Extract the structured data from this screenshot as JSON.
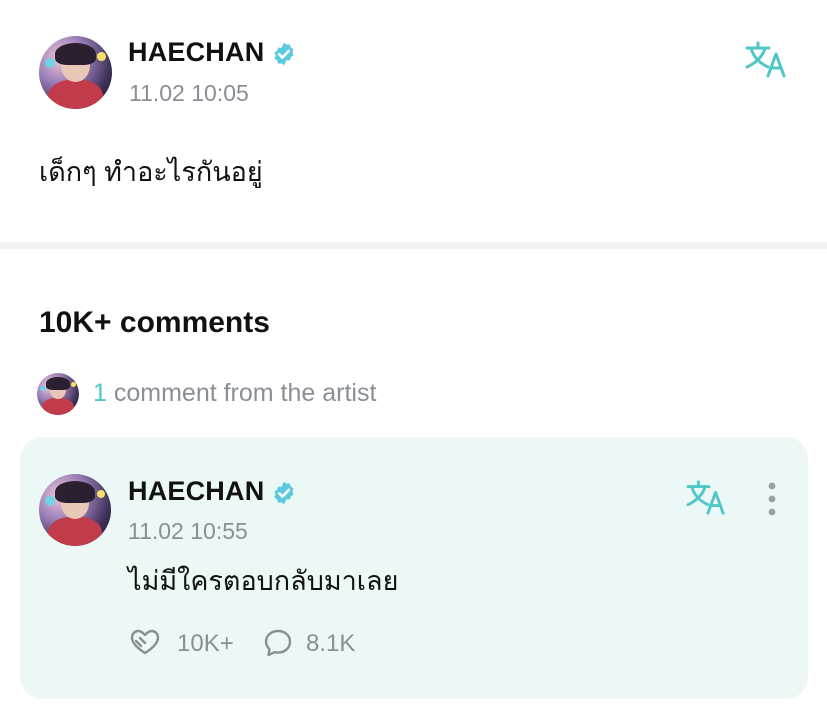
{
  "post": {
    "author": "HAECHAN",
    "verified": true,
    "time": "11.02 10:05",
    "text": "เด็กๆ ทำอะไรกันอยู่",
    "translate_icon": "translate-icon"
  },
  "comments": {
    "heading": "10K+ comments",
    "artist_count": "1",
    "artist_label": "comment from the artist"
  },
  "artist_comment": {
    "author": "HAECHAN",
    "verified": true,
    "time": "11.02 10:55",
    "text": "ไม่มีใครตอบกลับมาเลย",
    "likes": "10K+",
    "replies": "8.1K",
    "translate_icon": "translate-icon",
    "more_icon": "more-vertical-icon",
    "like_icon": "heart-hands-icon",
    "reply_icon": "speech-bubble-icon"
  },
  "colors": {
    "accent": "#4fc7c7",
    "card_bg": "#ebf8f5",
    "muted": "#8a8f96"
  }
}
